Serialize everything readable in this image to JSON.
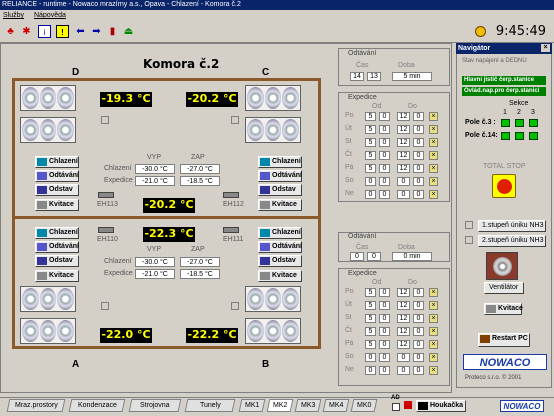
{
  "window": {
    "title": "RELIANCE - runtime - Nowaco mrazírny a.s., Opava - Chlazení - Komora č.2"
  },
  "menu": {
    "services": "Služby",
    "help": "Nápověda"
  },
  "clock": "9:45:49",
  "room": {
    "title": "Komora č.2",
    "corners": {
      "top_left": "D",
      "top_right": "C",
      "bottom_left": "A",
      "bottom_right": "B"
    },
    "upper": {
      "temp_left": "-19.3 °C",
      "temp_right": "-20.2 °C",
      "temp_center": "-20.2 °C",
      "col_vyp": "VYP",
      "col_zap": "ZAP",
      "row_chlazeni": "Chlazení",
      "row_expedice": "Expedice",
      "chl_vyp": "-30.0 °C",
      "chl_zap": "-27.0 °C",
      "exp_vyp": "-21.0 °C",
      "exp_zap": "-18.5 °C",
      "eh_left": "EH113",
      "eh_right": "EH112"
    },
    "lower": {
      "temp_left": "-22.0 °C",
      "temp_right": "-22.2 °C",
      "temp_center": "-22.3 °C",
      "col_vyp": "VYP",
      "col_zap": "ZAP",
      "row_chlazeni": "Chlazení",
      "row_expedice": "Expedice",
      "chl_vyp": "-30.0 °C",
      "chl_zap": "-27.0 °C",
      "exp_vyp": "-21.0 °C",
      "exp_zap": "-18.5 °C",
      "eh_left": "EH110",
      "eh_right": "EH111"
    },
    "buttons": {
      "chlazeni": "Chlazení",
      "odtavani": "Odtávání",
      "odstav": "Odstav",
      "kvitace": "Kvitace"
    }
  },
  "schedule_upper": {
    "odtavani_title": "Odtávání",
    "cas_label": "Čas",
    "doba_label": "Doba",
    "cas_h": "14",
    "cas_m": "13",
    "doba": "5 min",
    "expedice_title": "Expedice",
    "od_label": "Od",
    "do_label": "Do",
    "days": [
      "Po",
      "Út",
      "St",
      "Čt",
      "Pá",
      "So",
      "Ne"
    ],
    "od_h": [
      "5",
      "5",
      "5",
      "5",
      "5",
      "0",
      "0"
    ],
    "od_m": [
      "0",
      "0",
      "0",
      "0",
      "0",
      "0",
      "0"
    ],
    "do_h": [
      "12",
      "12",
      "12",
      "12",
      "12",
      "0",
      "0"
    ],
    "do_m": [
      "0",
      "0",
      "0",
      "0",
      "0",
      "0",
      "0"
    ]
  },
  "schedule_lower": {
    "odtavani_title": "Odtávání",
    "cas_label": "Čas",
    "doba_label": "Doba",
    "cas_h": "0",
    "cas_m": "0",
    "doba": "0 min",
    "expedice_title": "Expedice",
    "od_label": "Od",
    "do_label": "Do",
    "days": [
      "Po",
      "Út",
      "St",
      "Čt",
      "Pá",
      "So",
      "Ne"
    ],
    "od_h": [
      "5",
      "5",
      "5",
      "5",
      "5",
      "0",
      "0"
    ],
    "od_m": [
      "0",
      "0",
      "0",
      "0",
      "0",
      "0",
      "0"
    ],
    "do_h": [
      "12",
      "12",
      "12",
      "12",
      "12",
      "0",
      "0"
    ],
    "do_m": [
      "0",
      "0",
      "0",
      "0",
      "0",
      "0",
      "0"
    ]
  },
  "navigator": {
    "title": "Navigátor",
    "state_title": "Stav napájení a DEDNU",
    "status1": "Hlavní jistič čerp.stanice",
    "status2": "Ovlád.nap.pro čerp.stanici",
    "sekce": "Sekce",
    "sekce_nums": [
      "1",
      "2",
      "3"
    ],
    "pole3": "Pole č.3 :",
    "pole14": "Pole č.14:",
    "total_stop": "TOTAL STOP",
    "stupen1": "1.stupeň úniku NH3",
    "stupen2": "2.stupeň úniku NH3",
    "ventilator": "Ventilátor",
    "kvitace": "Kvitace",
    "restart": "Restart PC",
    "logo": "NOWACO",
    "footer": "Proteco s.r.o.   © 2001"
  },
  "tabs": [
    "Mraz.prostory",
    "Kondenzace",
    "Strojovna",
    "Tunely",
    "MK1",
    "MK2",
    "MK3",
    "MK4",
    "MK0"
  ],
  "active_tab": "MK2",
  "bottom": {
    "houkacka": "Houkačka",
    "logo": "NOWACO",
    "ad": "AD"
  }
}
